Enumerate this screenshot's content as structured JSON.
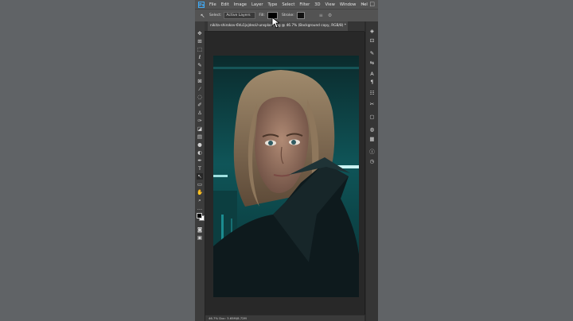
{
  "app": {
    "logo": "Ps",
    "menus": [
      "File",
      "Edit",
      "Image",
      "Layer",
      "Type",
      "Select",
      "Filter",
      "3D",
      "View",
      "Window",
      "Hel"
    ]
  },
  "options_bar": {
    "select_label": "Select:",
    "select_value": "Active Layers",
    "fill_label": "Fill:",
    "stroke_label": "Stroke:"
  },
  "document": {
    "tab_title": "nikita-shirokov-6Vu1jvjdeoU-unsplash.jpg @ 46.7% (Background copy, RGB/8) *"
  },
  "status": {
    "zoom_doc": "46.7%      Doc: 3.65M/8.72M"
  },
  "colors": {
    "foreground": "#000000",
    "background": "#ffffff",
    "photo_teal": "#0f5a5c"
  },
  "toolbar_icons": [
    "move-icon",
    "artboard-icon",
    "marquee-icon",
    "lasso-icon",
    "quick-select-icon",
    "crop-icon",
    "frame-icon",
    "eyedropper-icon",
    "spot-heal-icon",
    "brush-icon",
    "clone-stamp-icon",
    "history-brush-icon",
    "eraser-icon",
    "gradient-icon",
    "blur-icon",
    "dodge-icon",
    "pen-icon",
    "type-icon",
    "path-select-icon",
    "rectangle-icon",
    "hand-icon",
    "zoom-icon",
    "more-tools-icon"
  ],
  "panel_icons": [
    "layers-icon",
    "paths-icon",
    "brush-settings-icon",
    "adjustments-icon",
    "character-icon",
    "paragraph-icon",
    "properties-icon",
    "tool-presets-icon",
    "navigator-icon",
    "channels-icon",
    "histogram-icon",
    "info-icon"
  ]
}
